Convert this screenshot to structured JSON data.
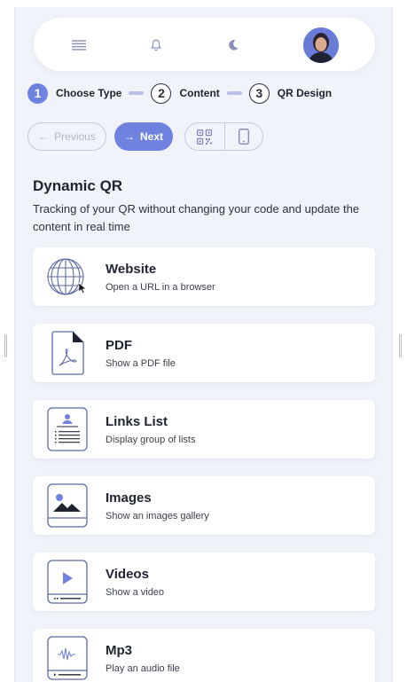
{
  "topbar": {
    "icons": [
      "menu-icon",
      "bell-icon",
      "moon-icon"
    ],
    "avatar": "user-avatar"
  },
  "stepper": {
    "steps": [
      {
        "number": "1",
        "label": "Choose Type",
        "state": "active"
      },
      {
        "number": "2",
        "label": "Content",
        "state": "idle"
      },
      {
        "number": "3",
        "label": "QR Design",
        "state": "idle"
      }
    ]
  },
  "actions": {
    "previous_label": "Previous",
    "next_label": "Next",
    "view_toggle": [
      "qr-code-icon",
      "phone-icon"
    ]
  },
  "section": {
    "title": "Dynamic QR",
    "description": "Tracking of your QR without changing your code and update the content in real time"
  },
  "cards": [
    {
      "title": "Website",
      "subtitle": "Open a URL in a browser",
      "icon": "globe-icon"
    },
    {
      "title": "PDF",
      "subtitle": "Show a PDF file",
      "icon": "pdf-icon"
    },
    {
      "title": "Links List",
      "subtitle": "Display group of lists",
      "icon": "links-list-icon"
    },
    {
      "title": "Images",
      "subtitle": "Show an images gallery",
      "icon": "images-icon"
    },
    {
      "title": "Videos",
      "subtitle": "Show a video",
      "icon": "video-icon"
    },
    {
      "title": "Mp3",
      "subtitle": "Play an audio file",
      "icon": "audio-icon"
    }
  ],
  "colors": {
    "accent": "#6f82e0",
    "panel_bg": "#f1f3fa",
    "icon_stroke": "#6877b8"
  }
}
